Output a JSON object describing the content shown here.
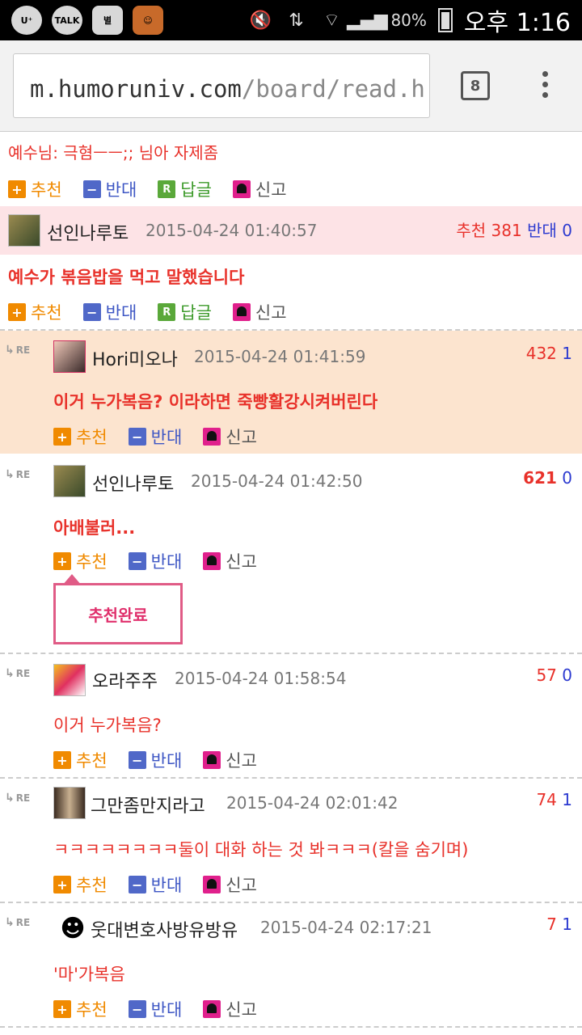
{
  "status_bar": {
    "battery": "80%",
    "time": "오후 1:16",
    "talk_label": "TALK",
    "app_label": "별"
  },
  "browser": {
    "url_host": "m.humoruniv.com",
    "url_path": "/board/read.h",
    "tab_count": "8"
  },
  "actions": {
    "up": "추천",
    "down": "반대",
    "reply": "답글",
    "report": "신고"
  },
  "re_label": "RE",
  "top_line": "예수님: 극혐ㅡㅡ;; 님아 자제좀",
  "comments": [
    {
      "name": "선인나루토",
      "date": "2015-04-24 01:40:57",
      "up_label": "추천",
      "up": "381",
      "down_label": "반대",
      "down": "0",
      "text": "예수가 볶음밥을 먹고 말했습니다"
    },
    {
      "name": "Hori미오나",
      "date": "2015-04-24 01:41:59",
      "up": "432",
      "down": "1",
      "text": "이거 누가복음? 이라하면 죽빵활강시켜버린다"
    },
    {
      "name": "선인나루토",
      "date": "2015-04-24 01:42:50",
      "up": "621",
      "down": "0",
      "text": "아배불러..."
    },
    {
      "name": "오라주주",
      "date": "2015-04-24 01:58:54",
      "up": "57",
      "down": "0",
      "text": "이거 누가복음?"
    },
    {
      "name": "그만좀만지라고",
      "date": "2015-04-24 02:01:42",
      "up": "74",
      "down": "1",
      "text": "ㅋㅋㅋㅋㅋㅋㅋㅋ둘이 대화 하는 것 봐ㅋㅋㅋ(칼을 숨기며)"
    },
    {
      "name": "웃대변호사방유방유",
      "date": "2015-04-24 02:17:21",
      "up": "7",
      "down": "1",
      "text": "'마'가복음"
    }
  ],
  "popup": "추천완료",
  "colors": {
    "accent_red": "#e8312a",
    "highlight_pink": "#fde3e6",
    "highlight_peach": "#fce4cf"
  }
}
